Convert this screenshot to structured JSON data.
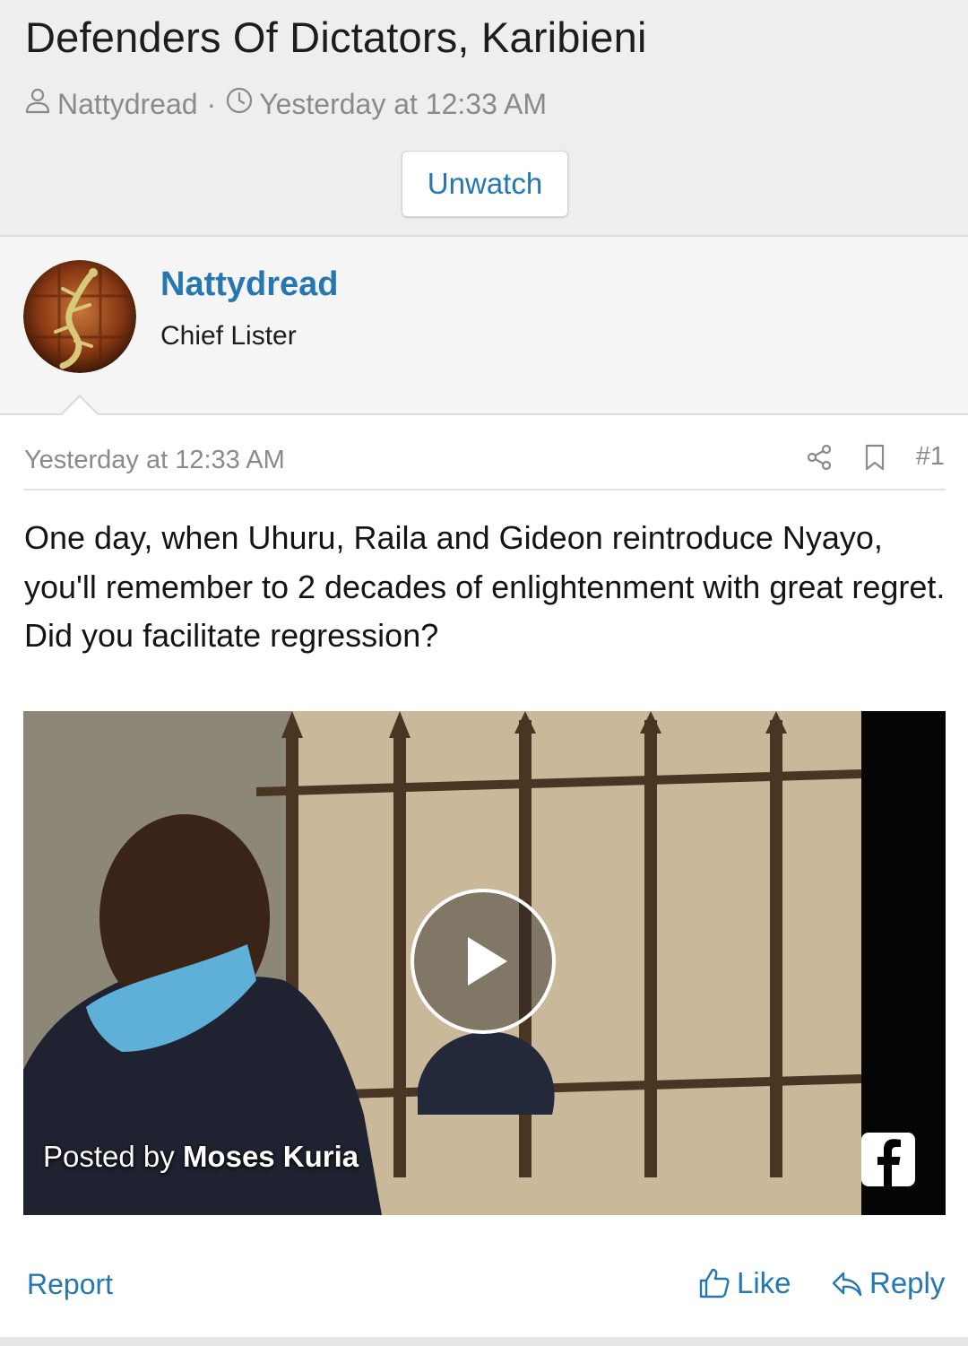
{
  "thread": {
    "title": "Defenders Of Dictators, Karibieni",
    "author": "Nattydread",
    "separator": "·",
    "date": "Yesterday at 12:33 AM",
    "unwatch_label": "Unwatch"
  },
  "post": {
    "username": "Nattydread",
    "user_title": "Chief Lister",
    "date": "Yesterday at 12:33 AM",
    "number": "#1",
    "body": "One day, when Uhuru, Raila and Gideon reintroduce Nyayo, you'll remember to 2 decades of enlightenment with great regret. Did you facilitate regression?",
    "video": {
      "caption_prefix": "Posted by ",
      "caption_name": "Moses Kuria",
      "source_icon": "facebook-icon"
    },
    "report_label": "Report",
    "like_label": "Like",
    "reply_label": "Reply"
  },
  "colors": {
    "link": "#2577b1",
    "muted": "#8a8a8a",
    "header_bg": "#eeeeee"
  }
}
